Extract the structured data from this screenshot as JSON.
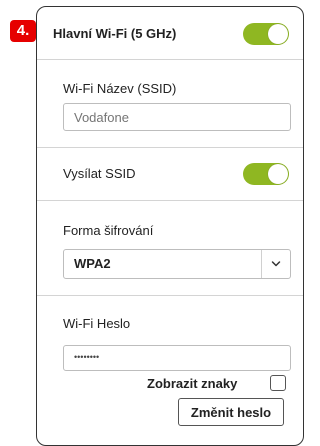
{
  "step_badge": "4.",
  "header": {
    "title": "Hlavní Wi-Fi (5 GHz)",
    "enabled": true
  },
  "ssid": {
    "label": "Wi-Fi Název (SSID)",
    "placeholder": "Vodafone"
  },
  "broadcast": {
    "label": "Vysílat SSID",
    "enabled": true
  },
  "encryption": {
    "label": "Forma šifrování",
    "selected": "WPA2"
  },
  "password": {
    "label": "Wi-Fi Heslo",
    "masked_value": "••••••••"
  },
  "show_chars": {
    "label": "Zobrazit znaky",
    "checked": false
  },
  "change_button": {
    "label": "Změnit heslo"
  },
  "colors": {
    "accent": "#8fb722",
    "badge": "#e60000"
  }
}
